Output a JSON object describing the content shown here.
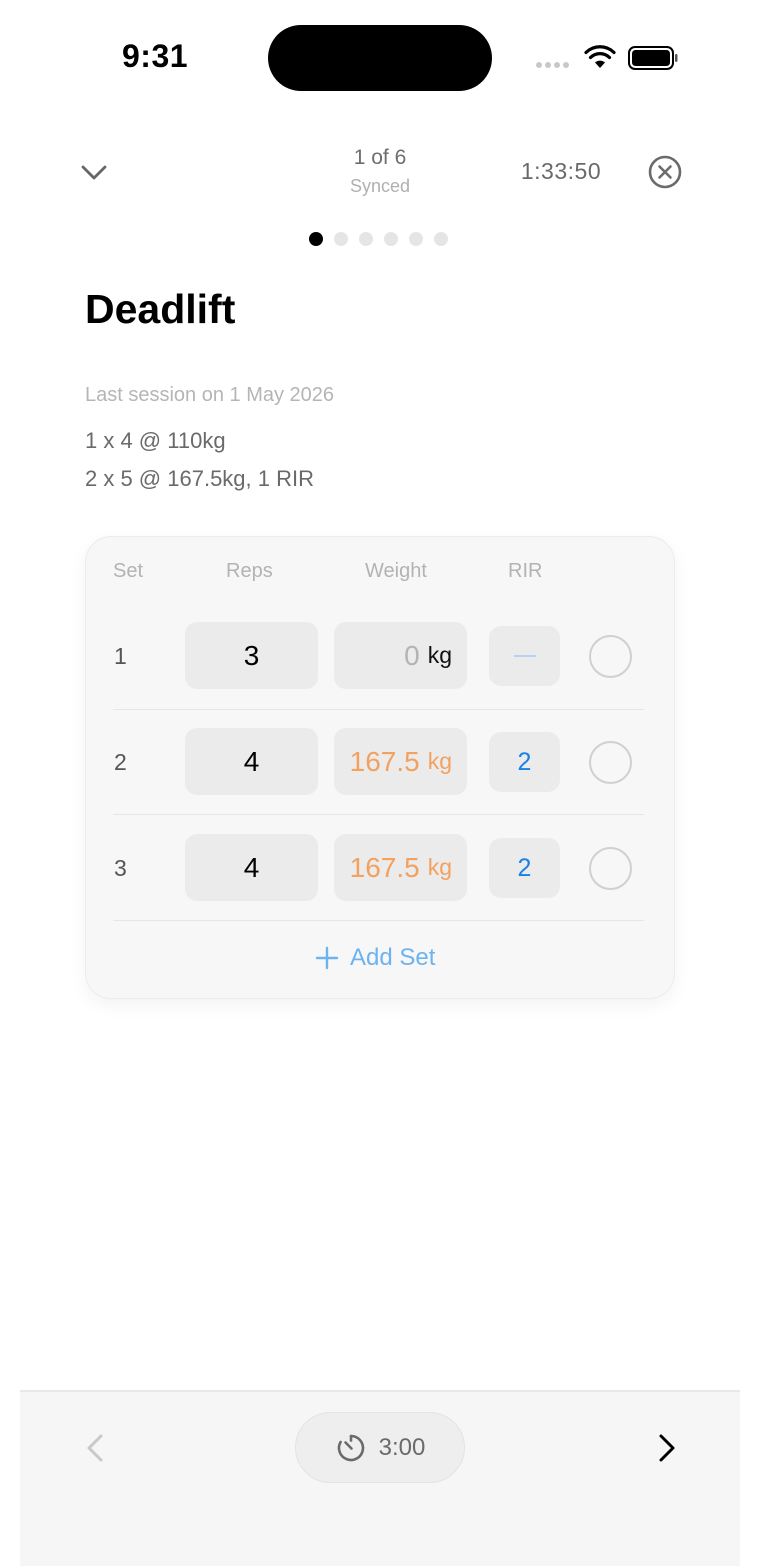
{
  "status_bar": {
    "time": "9:31"
  },
  "header": {
    "progress": "1 of 6",
    "sync_status": "Synced",
    "elapsed": "1:33:50",
    "page_count": 6,
    "active_page": 1
  },
  "exercise": {
    "name": "Deadlift",
    "last_session_label": "Last session on 1 May 2026",
    "previous_sets": [
      "1 x 4 @ 110kg",
      "2 x 5 @ 167.5kg, 1 RIR"
    ]
  },
  "table": {
    "headers": {
      "set": "Set",
      "reps": "Reps",
      "weight": "Weight",
      "rir": "RIR"
    },
    "rows": [
      {
        "set": "1",
        "reps": "3",
        "weight": "0",
        "unit": "kg",
        "rir": "",
        "done": false
      },
      {
        "set": "2",
        "reps": "4",
        "weight": "167.5",
        "unit": "kg",
        "rir": "2",
        "done": false
      },
      {
        "set": "3",
        "reps": "4",
        "weight": "167.5",
        "unit": "kg",
        "rir": "2",
        "done": false
      }
    ],
    "add_set_label": "Add Set"
  },
  "footer": {
    "rest_timer": "3:00"
  },
  "colors": {
    "accent_blue": "#1a7fe6",
    "suggested_orange": "#f2a15f",
    "muted_gray": "#b3b3b3"
  },
  "icons": {
    "collapse": "chevron-down-icon",
    "close": "close-circle-icon",
    "add": "plus-icon",
    "timer": "timer-icon",
    "previous": "chevron-left-icon",
    "next": "chevron-right-icon"
  }
}
